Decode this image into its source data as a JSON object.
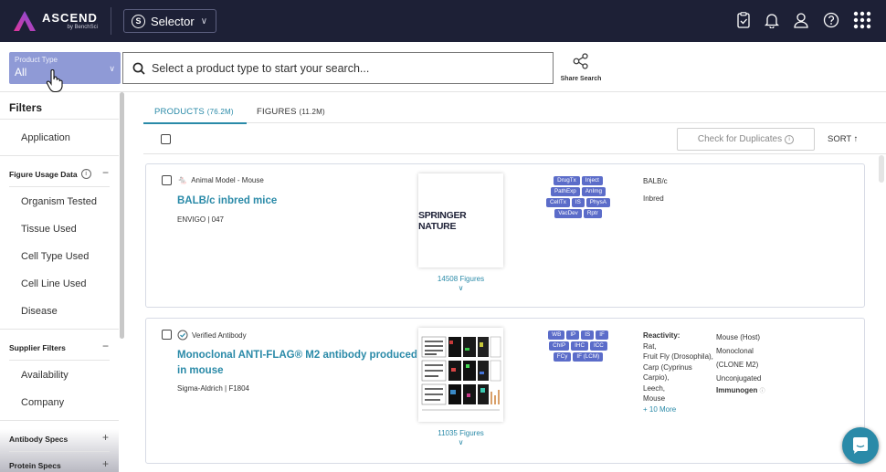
{
  "nav": {
    "logo_main": "ASCEND",
    "logo_sub": "by BenchSci",
    "selector_label": "Selector",
    "selector_icon": "S"
  },
  "search": {
    "product_type_label": "Product Type",
    "product_type_value": "All",
    "placeholder": "Select a product type to start your search...",
    "share_label": "Share Search"
  },
  "sidebar": {
    "heading": "Filters",
    "application": "Application",
    "figure_usage_group": "Figure Usage Data",
    "figure_items": [
      "Organism Tested",
      "Tissue Used",
      "Cell Type Used",
      "Cell Line Used",
      "Disease"
    ],
    "supplier_group": "Supplier Filters",
    "supplier_items": [
      "Availability",
      "Company"
    ],
    "antibody_group": "Antibody Specs",
    "protein_group": "Protein Specs"
  },
  "tabs": {
    "products": "PRODUCTS",
    "products_count": "(76.2M)",
    "figures": "FIGURES",
    "figures_count": "(11.2M)"
  },
  "toolbar": {
    "duplicates": "Check for Duplicates",
    "sort": "SORT ↑"
  },
  "cards": [
    {
      "type": "Animal Model - Mouse",
      "title": "BALB/c inbred mice",
      "supplier": "ENVIGO | 047",
      "image_text": "SPRINGER NATURE",
      "figures": "14508 Figures",
      "badges": [
        [
          "DrugTx",
          "Inject"
        ],
        [
          "PathExp",
          "AnImg"
        ],
        [
          "CellTx",
          "IS",
          "PhysA"
        ],
        [
          "VacDev",
          "Rptr"
        ]
      ],
      "attr1": "BALB/c",
      "attr2": "Inbred"
    },
    {
      "type": "Verified Antibody",
      "title_line1": "Monoclonal ANTI-FLAG® M2 antibody produced",
      "title_line2": "in mouse",
      "supplier": "Sigma-Aldrich | F1804",
      "figures": "11035 Figures",
      "badges": [
        [
          "WB",
          "IP",
          "IS",
          "IF"
        ],
        [
          "ChIP",
          "IHC",
          "ICC"
        ],
        [
          "FCy",
          "IF (LCM)"
        ]
      ],
      "reactivity_label": "Reactivity:",
      "reactivity": [
        "Rat,",
        "Fruit Fly (Drosophila),",
        "Carp (Cyprinus",
        "Carpio),",
        "Leech,",
        "Mouse"
      ],
      "more": "+ 10 More",
      "host": "Mouse (Host)",
      "clonality": "Monoclonal",
      "clone": "(CLONE M2)",
      "conjugate": "Unconjugated",
      "immunogen": "Immunogen"
    }
  ],
  "colors": {
    "nav_bg": "#1d2036",
    "accent": "#2a8aa8",
    "badge": "#5b6cc9",
    "product_type_bg": "#8f9ad6"
  }
}
